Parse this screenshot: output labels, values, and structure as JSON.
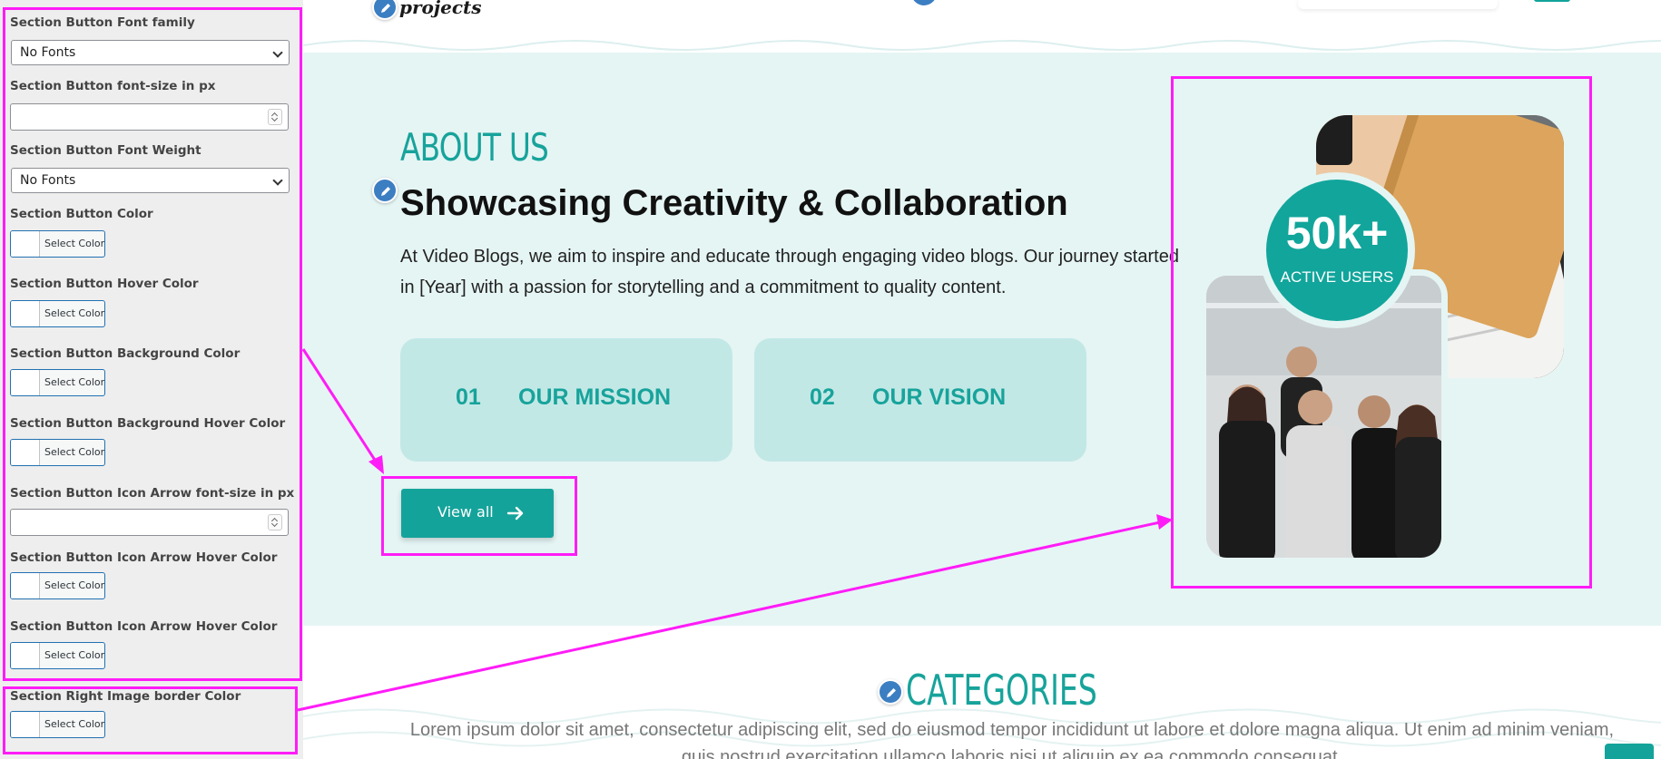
{
  "panel": {
    "font_family_label": "Section Button Font family",
    "font_family_value": "No Fonts",
    "font_size_label": "Section Button font-size in px",
    "font_size_value": "",
    "font_weight_label": "Section Button Font Weight",
    "font_weight_value": "No Fonts",
    "color_label": "Section Button Color",
    "hover_color_label": "Section Button Hover Color",
    "bg_color_label": "Section Button Background Color",
    "bg_hover_color_label": "Section Button Background Hover Color",
    "icon_size_label": "Section Button Icon Arrow font-size in px",
    "icon_size_value": "",
    "icon_hover_color_label": "Section Button Icon Arrow Hover Color",
    "icon_hover_color2_label": "Section Button Icon Arrow Hover Color",
    "right_image_border_label": "Section Right Image border Color",
    "select_color_label": "Select Color"
  },
  "header": {
    "logo_text": "projects"
  },
  "about": {
    "kicker": "ABOUT US",
    "title": "Showcasing Creativity & Collaboration",
    "text": "At Video Blogs, we aim to inspire and educate through engaging video blogs. Our journey started in [Year] with a passion for storytelling and a commitment to quality content.",
    "cards": [
      {
        "number": "01",
        "label": "OUR MISSION"
      },
      {
        "number": "02",
        "label": "OUR VISION"
      }
    ],
    "button_label": "View all",
    "badge_value": "50k+",
    "badge_label": "ACTIVE USERS"
  },
  "categories": {
    "title": "CATEGORIES",
    "text": "Lorem ipsum dolor sit amet, consectetur adipiscing elit, sed do eiusmod tempor incididunt ut labore et dolore magna aliqua. Ut enim ad minim veniam, quis nostrud exercitation ullamco laboris nisi ut aliquip ex ea commodo consequat."
  },
  "colors": {
    "accent": "#14a39a",
    "section_bg": "#e5f5f4",
    "card_bg": "#c2e8e6",
    "highlight": "#ff1cf7",
    "edit_icon": "#3c7ec2"
  },
  "icons": {
    "edit": "pencil-icon",
    "arrow": "arrow-right-icon",
    "dropdown": "chevron-down-icon"
  }
}
